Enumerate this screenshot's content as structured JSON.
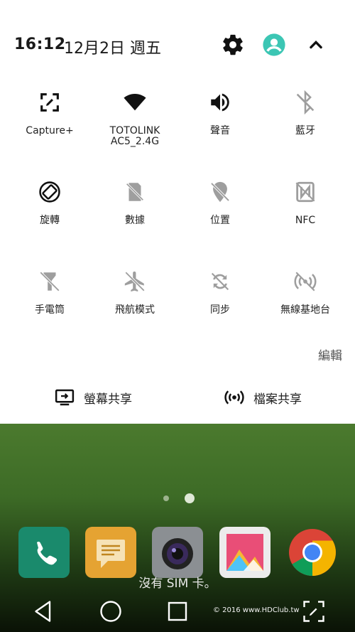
{
  "status": {
    "time": "16:12",
    "date": "12月2日 週五"
  },
  "header_icons": [
    "settings-gear-icon",
    "user-account-icon",
    "collapse-chevron-icon"
  ],
  "tiles": [
    {
      "label": "Capture+",
      "icon": "capture-plus-icon",
      "enabled": true
    },
    {
      "label": "TOTOLINK\nAC5_2.4G",
      "icon": "wifi-icon",
      "enabled": true
    },
    {
      "label": "聲音",
      "icon": "sound-icon",
      "enabled": true
    },
    {
      "label": "藍牙",
      "icon": "bluetooth-off-icon",
      "enabled": false
    },
    {
      "label": "旋轉",
      "icon": "rotate-icon",
      "enabled": true
    },
    {
      "label": "數據",
      "icon": "mobile-data-off-icon",
      "enabled": false
    },
    {
      "label": "位置",
      "icon": "location-off-icon",
      "enabled": false
    },
    {
      "label": "NFC",
      "icon": "nfc-off-icon",
      "enabled": false
    },
    {
      "label": "手電筒",
      "icon": "flashlight-off-icon",
      "enabled": false
    },
    {
      "label": "飛航模式",
      "icon": "airplane-off-icon",
      "enabled": false
    },
    {
      "label": "同步",
      "icon": "sync-off-icon",
      "enabled": false
    },
    {
      "label": "無線基地台",
      "icon": "hotspot-off-icon",
      "enabled": false
    }
  ],
  "edit_label": "編輯",
  "share": {
    "screen_label": "螢幕共享",
    "file_label": "檔案共享"
  },
  "home": {
    "sim_message": "沒有 SIM 卡。",
    "watermark": "© 2016  www.HDClub.tw",
    "dock_apps": [
      "phone-app",
      "messages-app",
      "camera-app",
      "gallery-app",
      "chrome-app"
    ]
  },
  "colors": {
    "icon_active": "#111111",
    "icon_inactive": "#9e9e9e",
    "accent_user": "#3cc6b4",
    "panel_bg": "#ffffff",
    "wallpaper": "#3d6b26"
  }
}
